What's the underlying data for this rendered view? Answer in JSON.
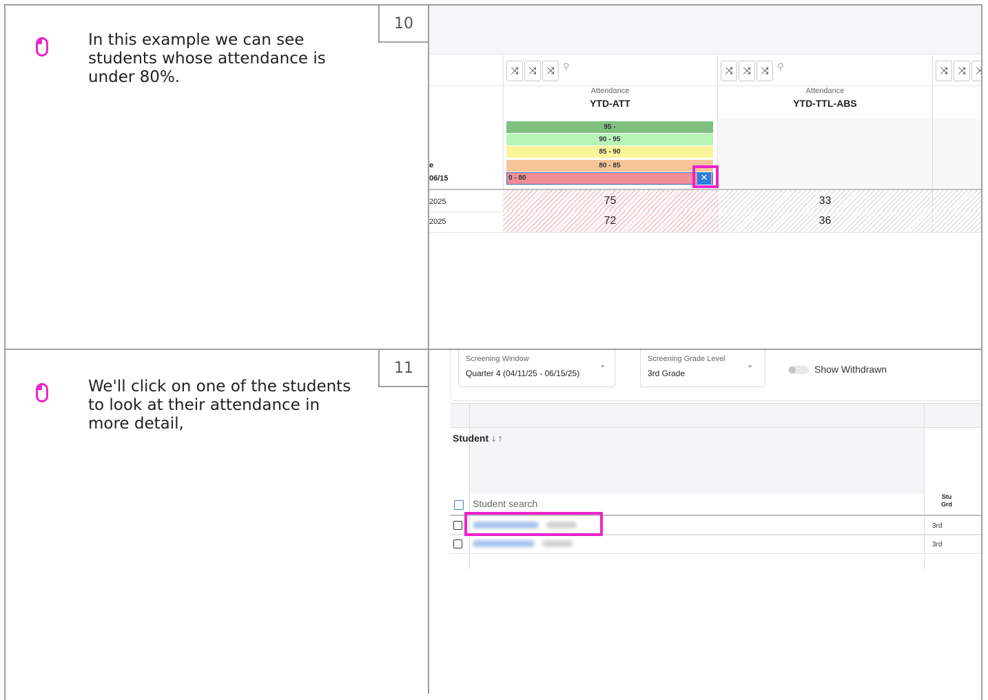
{
  "steps": [
    {
      "number": "10",
      "instruction": "In this example we can see students whose attendance is under 80%.",
      "screenshot": {
        "columns": [
          {
            "category": "Attendance",
            "code": "YTD-ATT"
          },
          {
            "category": "Attendance",
            "code": "YTD-TTL-ABS"
          }
        ],
        "left_labels": [
          "e",
          "06/15"
        ],
        "filter_bands": [
          {
            "label": "95 -",
            "color": "#7fbf7f"
          },
          {
            "label": "90 - 95",
            "color": "#b6f5b6"
          },
          {
            "label": "85 - 90",
            "color": "#fbf59a"
          },
          {
            "label": "80 - 85",
            "color": "#f7c49a"
          },
          {
            "label": "0 - 80",
            "color": "#ef8f96",
            "selected": true
          }
        ],
        "clear_glyph": "✕",
        "tool_glyph": "⤨",
        "pin_glyph": "⚲",
        "rows": [
          {
            "date": "2025",
            "ytd_att": "75",
            "ytd_ttl_abs": "33"
          },
          {
            "date": "2025",
            "ytd_att": "72",
            "ytd_ttl_abs": "36"
          }
        ]
      }
    },
    {
      "number": "11",
      "instruction": "We'll click on one of the students to look at their attendance in more detail,",
      "screenshot": {
        "filters": [
          {
            "label": "Screening Window",
            "value": "Quarter 4 (04/11/25 - 06/15/25)"
          },
          {
            "label": "Screening Grade Level",
            "value": "3rd Grade"
          }
        ],
        "chevron": "⌄",
        "toggle_label": "Show Withdrawn",
        "student_header": "Student",
        "sort_glyph": "↓↑",
        "search_placeholder": "Student search",
        "grade_col_header": [
          "Stu",
          "Grd"
        ],
        "rows": [
          {
            "grade": "3rd"
          },
          {
            "grade": "3rd"
          }
        ]
      }
    }
  ],
  "colors": {
    "highlight": "#ee22cc",
    "icon": "#ee22cc",
    "divider": "#9e9e9e"
  }
}
